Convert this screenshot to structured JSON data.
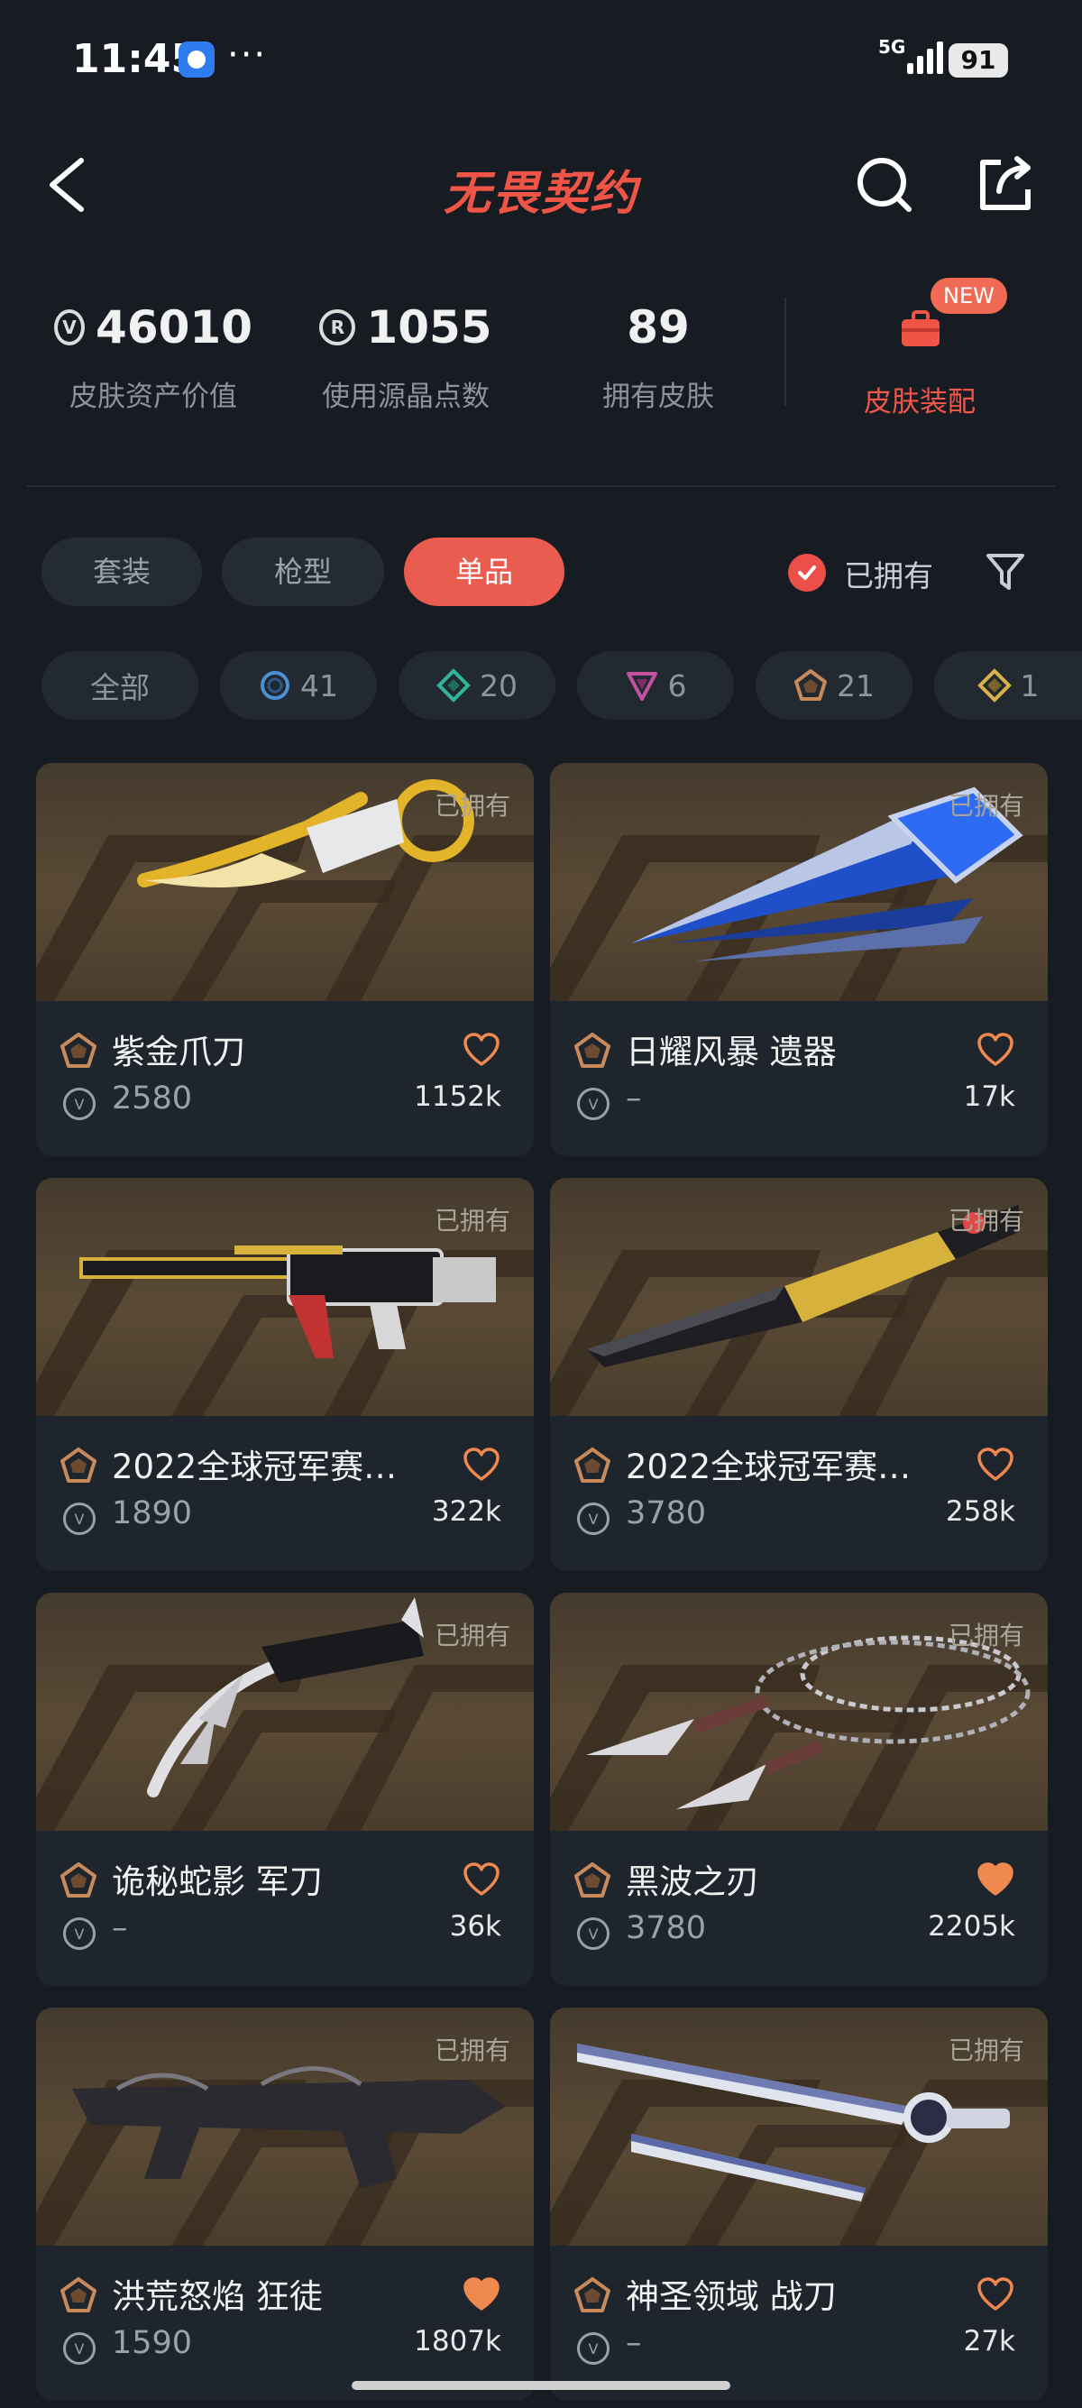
{
  "status_bar": {
    "time": "11:45",
    "dots": "···",
    "network": "5G",
    "battery": "91"
  },
  "header": {
    "title": "无畏契约"
  },
  "stats": [
    {
      "value": "46010",
      "label": "皮肤资产价值",
      "icon": "vp-coin-icon"
    },
    {
      "value": "1055",
      "label": "使用源晶点数",
      "icon": "radianite-icon"
    },
    {
      "value": "89",
      "label": "拥有皮肤"
    }
  ],
  "equip": {
    "label": "皮肤装配",
    "badge": "NEW"
  },
  "segments": {
    "items": [
      "套装",
      "枪型",
      "单品"
    ],
    "active": "单品"
  },
  "owned_filter": {
    "label": "已拥有",
    "checked": true
  },
  "rarity_chips": [
    {
      "label": "全部"
    },
    {
      "count": "41",
      "color": "#4a8fd6",
      "icon": "select-tier-icon"
    },
    {
      "count": "20",
      "color": "#2fb59b",
      "icon": "deluxe-tier-icon"
    },
    {
      "count": "6",
      "color": "#c44fa3",
      "icon": "premium-tier-icon"
    },
    {
      "count": "21",
      "color": "#c98a5b",
      "icon": "exclusive-tier-icon"
    },
    {
      "count": "1",
      "color": "#d9b34a",
      "icon": "ultra-tier-icon"
    }
  ],
  "cards": [
    {
      "name": "紫金爪刀",
      "price": "2580",
      "likes": "1152k",
      "owned": "已拥有",
      "liked": false
    },
    {
      "name": "日耀风暴 遗器",
      "price": "–",
      "likes": "17k",
      "owned": "已拥有",
      "liked": false
    },
    {
      "name": "2022全球冠军赛…",
      "price": "1890",
      "likes": "322k",
      "owned": "已拥有",
      "liked": false
    },
    {
      "name": "2022全球冠军赛…",
      "price": "3780",
      "likes": "258k",
      "owned": "已拥有",
      "liked": false
    },
    {
      "name": "诡秘蛇影 军刀",
      "price": "–",
      "likes": "36k",
      "owned": "已拥有",
      "liked": false
    },
    {
      "name": "黑波之刃",
      "price": "3780",
      "likes": "2205k",
      "owned": "已拥有",
      "liked": true
    },
    {
      "name": "洪荒怒焰 狂徒",
      "price": "1590",
      "likes": "1807k",
      "owned": "已拥有",
      "liked": true
    },
    {
      "name": "神圣领域 战刀",
      "price": "–",
      "likes": "27k",
      "owned": "已拥有",
      "liked": false
    }
  ],
  "colors": {
    "accent": "#eb5c50",
    "background": "#171c23",
    "card": "#1f252d",
    "heart": "#f0894f"
  }
}
